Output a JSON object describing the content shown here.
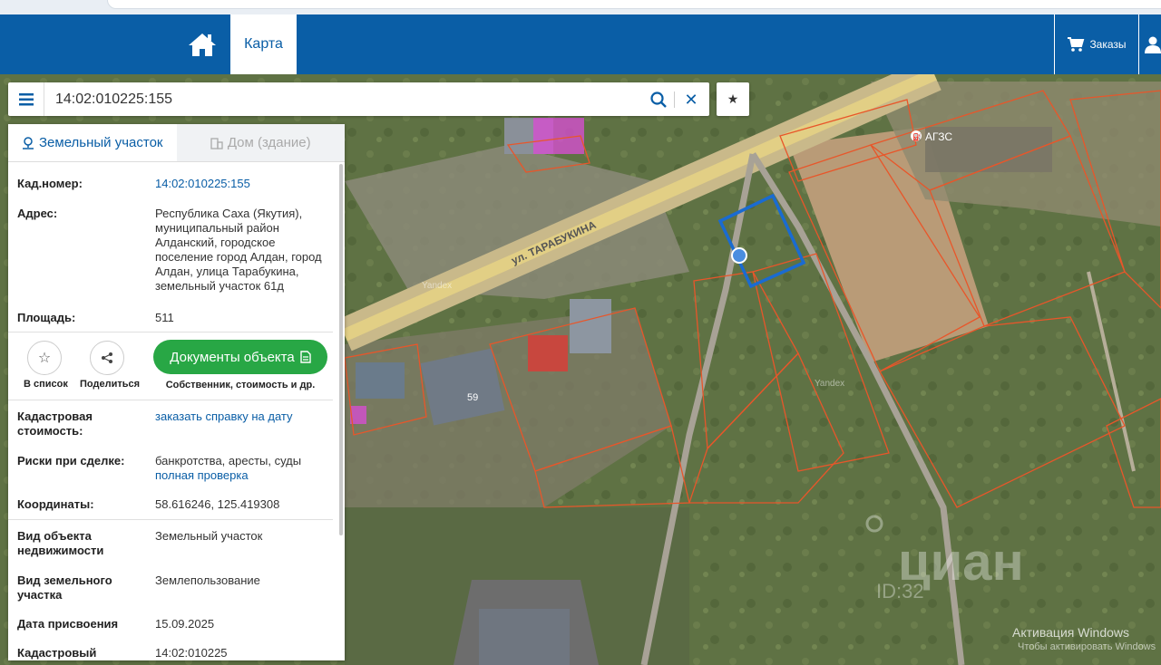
{
  "nav": {
    "map_tab": "Карта",
    "orders": "Заказы"
  },
  "search": {
    "value": "14:02:010225:155"
  },
  "panel": {
    "tab_land": "Земельный участок",
    "tab_house": "Дом (здание)",
    "rows": {
      "cad_label": "Кад.номер:",
      "cad_value": "14:02:010225:155",
      "addr_label": "Адрес:",
      "addr_value": "Республика Саха (Якутия), муниципальный район Алданский, городское поселение город Алдан, город Алдан, улица Тарабукина, земельный участок 61д",
      "area_label": "Площадь:",
      "area_value": "511",
      "cost_label": "Кадастровая стоимость:",
      "cost_value": "заказать справку на дату",
      "risk_label": "Риски при сделке:",
      "risk_value": "банкротства, аресты, суды",
      "risk_link": "полная проверка",
      "coords_label": "Координаты:",
      "coords_value": "58.616246, 125.419308",
      "type_label": "Вид объекта недвижимости",
      "type_value": "Земельный участок",
      "land_label": "Вид земельного участка",
      "land_value": "Землепользование",
      "date_label": "Дата присвоения",
      "date_value": "15.09.2025",
      "cadq_label": "Кадастровый",
      "cadq_value": "14:02:010225"
    },
    "actions": {
      "to_list": "В список",
      "share": "Поделиться",
      "docs_button": "Документы объекта",
      "docs_sub": "Собственник, стоимость и др."
    }
  },
  "map": {
    "street_label": "ул. ТАРАБУКИНА",
    "gas_label": "АГЗС",
    "house_number": "59",
    "yandex1": "Yandex",
    "yandex2": "Yandex",
    "cian": "циан",
    "cian_id": "ID:32"
  },
  "os": {
    "activate": "Активация Windows",
    "activate_sub": "Чтобы активировать Windows"
  },
  "colors": {
    "brand": "#0a5ea6",
    "green": "#28a745",
    "parcel_outline": "#e8562a",
    "selected_parcel": "#1a6bd1"
  }
}
